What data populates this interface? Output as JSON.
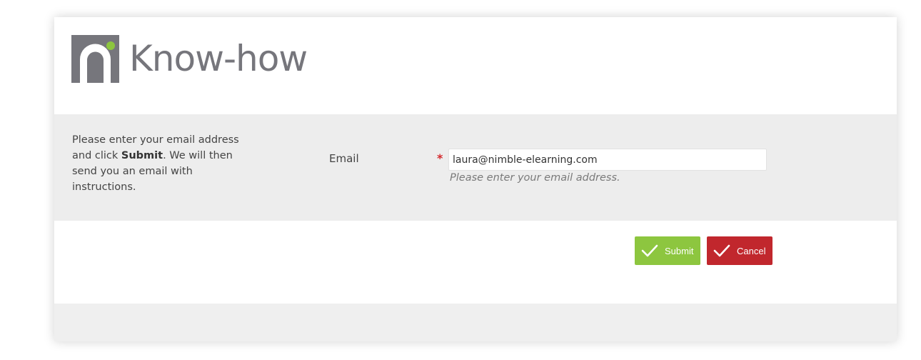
{
  "brand": {
    "name": "Know-how",
    "logo_icon": "n-logo-icon",
    "logo_gray": "#76767c",
    "logo_green": "#8dc63f"
  },
  "instructions": {
    "before_bold": "Please enter your email address and click ",
    "bold": "Submit",
    "after_bold": ". We will then send you an email with instructions."
  },
  "form": {
    "email_label": "Email",
    "required_mark": "*",
    "email_value": "laura@nimble-elearning.com",
    "email_hint": "Please enter your email address."
  },
  "buttons": {
    "submit_label": "Submit",
    "submit_icon": "checkmark-icon",
    "submit_color": "#8dc63f",
    "cancel_label": "Cancel",
    "cancel_icon": "checkmark-icon",
    "cancel_color": "#c1272d"
  }
}
